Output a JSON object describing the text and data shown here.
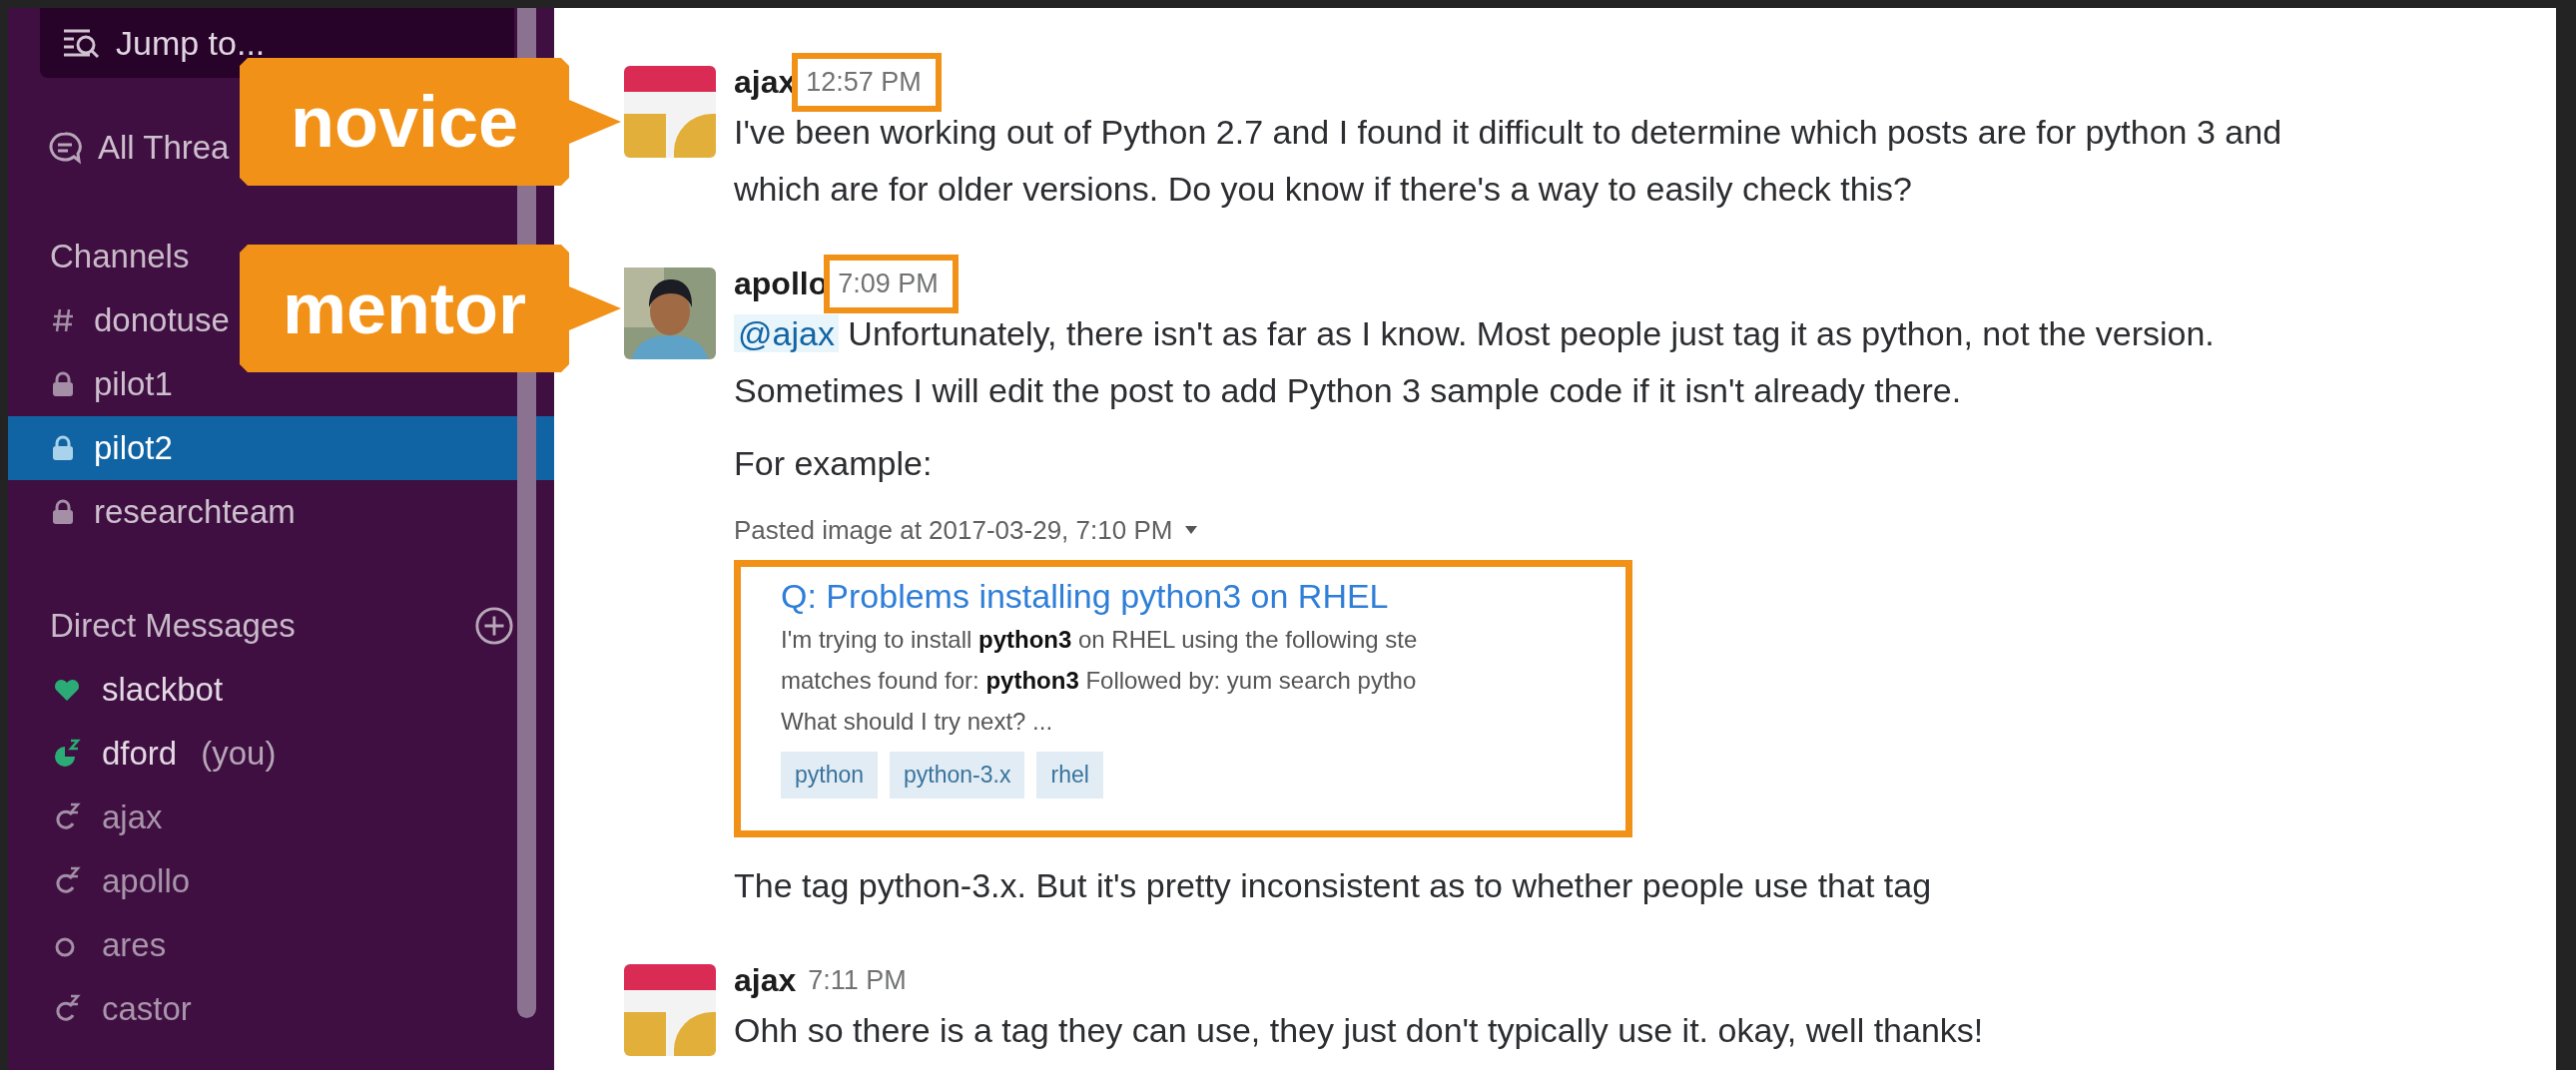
{
  "sidebar": {
    "jump_to": {
      "placeholder": "Jump to..."
    },
    "all_threads": {
      "label": "All Threa"
    },
    "channels": {
      "title": "Channels",
      "items": [
        {
          "name": "donotuse",
          "kind": "public",
          "selected": false
        },
        {
          "name": "pilot1",
          "kind": "private",
          "selected": false
        },
        {
          "name": "pilot2",
          "kind": "private",
          "selected": true
        },
        {
          "name": "researchteam",
          "kind": "private",
          "selected": false
        }
      ]
    },
    "direct_messages": {
      "title": "Direct Messages",
      "items": [
        {
          "name": "slackbot",
          "kind": "bot"
        },
        {
          "name": "dford",
          "suffix": "(you)",
          "kind": "self"
        },
        {
          "name": "ajax",
          "kind": "away"
        },
        {
          "name": "apollo",
          "kind": "away"
        },
        {
          "name": "ares",
          "kind": "offline"
        },
        {
          "name": "castor",
          "kind": "away"
        }
      ]
    }
  },
  "messages": [
    {
      "author": "ajax",
      "time": "12:57 PM",
      "avatar": {
        "kind": "tiles"
      },
      "time_highlighted": true,
      "blocks": [
        {
          "kind": "text",
          "text": "I've been working out of Python 2.7 and I found it difficult to determine which posts are for python 3 and\nwhich are for older versions. Do you know if there's a way to easily check this?"
        }
      ]
    },
    {
      "author": "apollo",
      "time": "7:09 PM",
      "time_highlighted": true,
      "blocks": [
        {
          "kind": "text",
          "mention": "@ajax",
          "text": "Unfortunately, there isn't as far as I know. Most people just tag it as python, not the version.\nSometimes I will edit the post to add Python 3 sample code if it isn't already there."
        },
        {
          "kind": "text",
          "text": "For example:"
        },
        {
          "kind": "attachment",
          "caption": "Pasted image at 2017-03-29, 7:10 PM",
          "highlighted": true,
          "title": "Q: Problems installing python3 on RHEL",
          "snippet": [
            "I'm trying to install **python3** on RHEL using the following ste",
            "matches found for: **python3** Followed by: yum search pytho",
            "What should I try next? ..."
          ],
          "tags": [
            "python",
            "python-3.x",
            "rhel"
          ]
        },
        {
          "kind": "text",
          "text": "The tag python-3.x. But it's pretty inconsistent as to whether people use that tag"
        }
      ]
    },
    {
      "author": "ajax",
      "time": "7:11 PM",
      "avatar": {
        "kind": "tiles"
      },
      "time_highlighted": false,
      "blocks": [
        {
          "kind": "text",
          "text": "Ohh so there is a tag they can use, they just don't typically use it. okay, well thanks!"
        }
      ]
    }
  ],
  "callouts": [
    {
      "label": "novice"
    },
    {
      "label": "mentor"
    }
  ]
}
